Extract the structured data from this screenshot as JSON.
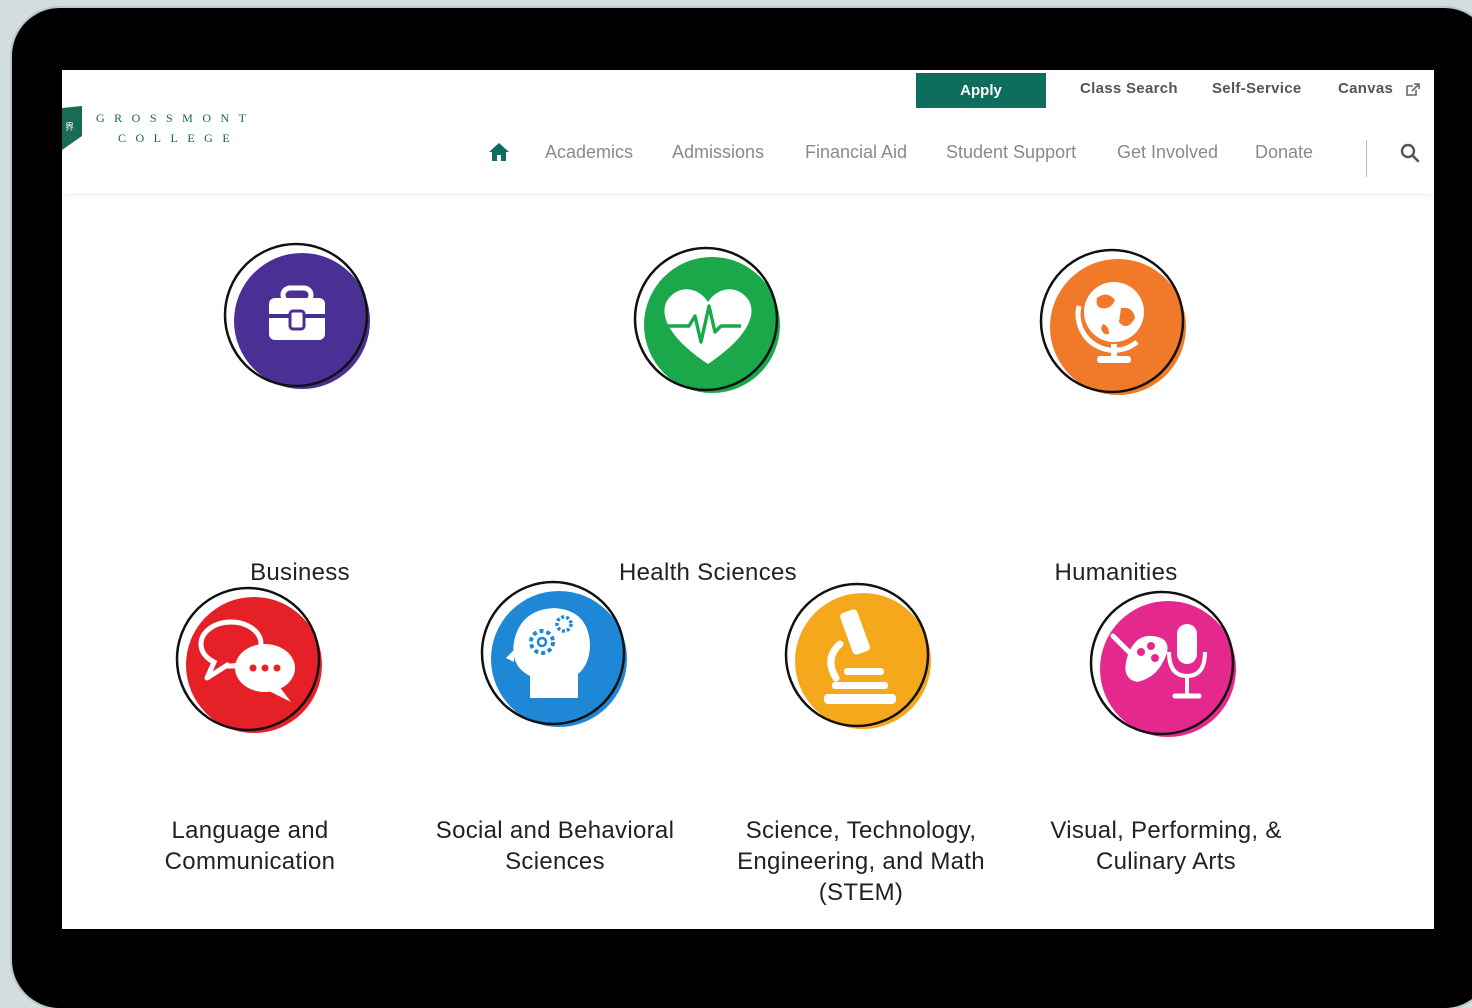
{
  "college": {
    "name_line1": "GROSSMONT",
    "name_line2": "COLLEGE"
  },
  "utility_nav": {
    "apply": "Apply",
    "class_search": "Class Search",
    "self_service": "Self-Service",
    "canvas": "Canvas"
  },
  "main_nav": {
    "items": [
      "Academics",
      "Admissions",
      "Financial Aid",
      "Student Support",
      "Get Involved",
      "Donate"
    ]
  },
  "areas": [
    {
      "label": "Business",
      "color": "#4a2f95",
      "icon": "briefcase-icon"
    },
    {
      "label": "Health Sciences",
      "color": "#1aa84b",
      "icon": "heartbeat-icon"
    },
    {
      "label": "Humanities",
      "color": "#f07a2a",
      "icon": "globe-icon"
    },
    {
      "label": "Language and Communication",
      "color": "#e52127",
      "icon": "speech-bubbles-icon"
    },
    {
      "label": "Social and Behavioral Sciences",
      "color": "#1f88d6",
      "icon": "head-gears-icon"
    },
    {
      "label": "Science, Technology, Engineering, and Math (STEM)",
      "color": "#f6a81c",
      "icon": "microscope-icon"
    },
    {
      "label": "Visual, Performing, & Culinary Arts",
      "color": "#e5288e",
      "icon": "palette-microphone-icon"
    }
  ],
  "colors": {
    "brand_green": "#0d6e5e"
  }
}
